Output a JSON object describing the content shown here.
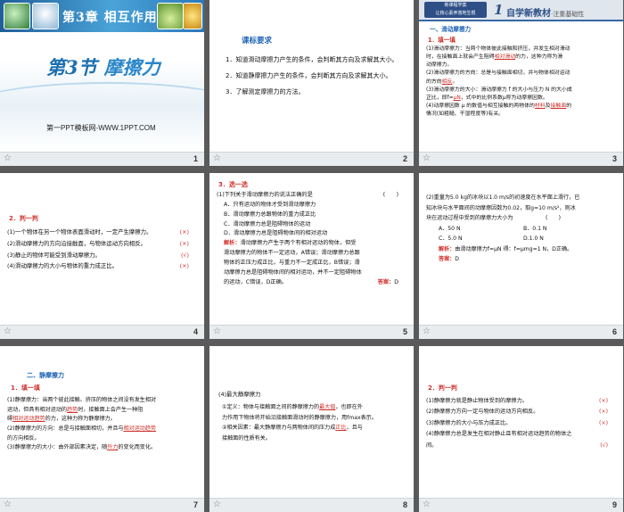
{
  "slides": [
    {
      "number": "1",
      "chapter": "第3章  相互作用",
      "section": "第3节",
      "section_name": "摩擦力",
      "footer": "第一PPT模板网-WWW.1PPT.COM"
    },
    {
      "number": "2",
      "title": "课标要求",
      "items": [
        "1．知道滑动摩擦力产生的条件，会判断其方向及求解其大小。",
        "2．知道静摩擦力产生的条件，会判断其方向及求解其大小。",
        "3．了解测定摩擦力的方法。"
      ]
    },
    {
      "number": "3",
      "badge_line1": "新课程学案",
      "badge_line2": "让核心素养落地生根",
      "header_num": "1",
      "header_title": "自学新教材",
      "header_sub": "·注重基础性",
      "section": "一、滑动摩擦力",
      "sub": "1．填一填",
      "lines": [
        "(1)滑动摩擦力：当两个物体彼此接触和挤压，并发生相对滑动",
        "时，在接触面上就会产生阻碍",
        "的力，这种力称为滑",
        "动摩擦力。",
        "(2)滑动摩擦力的方向：总是与接触面相切，并与物体相对运动",
        "的方向",
        "。",
        "(3)滑动摩擦力的大小：滑动摩擦力 f 的大小与压力 N 的大小成",
        "正比，即f=",
        "，式中的比例系数μ称为动摩擦因数。",
        "(4)动摩擦因数 μ 的数值与相互接触的两物体的",
        "及",
        "的",
        "情况(如粗糙、干湿程度等)有关。"
      ],
      "fill_relative_slide": "相对滑动",
      "fill_opposite": "相反",
      "fill_formula": "μN",
      "fill_material": "材料",
      "fill_surface": "接触面"
    },
    {
      "number": "4",
      "title": "2．判一判",
      "items": [
        {
          "text": "(1)一个物体在另一个物体表面滑动时，一定产生摩擦力。",
          "mark": "(×)"
        },
        {
          "text": "(2)滑动摩擦力的方向沿接触面，与物体运动方向相反。",
          "mark": "(×)"
        },
        {
          "text": "(3)静止的物体可能受到滑动摩擦力。",
          "mark": "(√)"
        },
        {
          "text": "(4)滑动摩擦力的大小与物体的重力成正比。",
          "mark": "(×)"
        }
      ]
    },
    {
      "number": "5",
      "title": "3．选一选",
      "question": "(1)下列关于滑动摩擦力的说法正确的是",
      "paren": "(　　)",
      "options": [
        "A．只有运动的物体才受到滑动摩擦力",
        "B．滑动摩擦力总跟物体的重力成正比",
        "C．滑动摩擦力总是阻碍物体的运动",
        "D．滑动摩擦力总是阻碍物体间的相对运动"
      ],
      "analysis_label": "解析：",
      "analysis": [
        "滑动摩擦力产生于两个有相对运动的物体，但受",
        "滑动摩擦力的物体不一定运动，A错误；滑动摩擦力总跟",
        "物体的正压力成正比，与重力不一定成正比，B错误；滑",
        "动摩擦力总是阻碍物体间的相对运动，并不一定阻碍物体",
        "的运动，C错误，D正确。"
      ],
      "answer_label": "答案：",
      "answer": "D"
    },
    {
      "number": "6",
      "lines": [
        "(2)重量为5.0 kg的冰块以1.0 m/s的初速度在水平面上滑行，已",
        "知冰块与水平面间的动摩擦因数为0.02，取g=10 m/s²，则冰",
        "块在运动过程中受到的摩擦力大小为　　　　　　(　　)"
      ],
      "options": [
        {
          "a": "A．50 N",
          "b": "B．0.1 N"
        },
        {
          "a": "C．5.0 N",
          "b": "D.1.0 N"
        }
      ],
      "analysis_label": "解析：",
      "analysis": "由滑动摩擦力f=μN 得：f=μmg=1 N，D正确。",
      "answer_label": "答案：",
      "answer": "D"
    },
    {
      "number": "7",
      "section": "二、静摩擦力",
      "sub": "1．填一填",
      "lines": [
        "(1)静摩擦力：当两个彼此接触、挤压的物体之间没有发生相对",
        "运动，但具有相对运动的",
        "时，接触面上会产生一种阻",
        "碍",
        "的力，这种力称为静摩擦力。",
        "(2)静摩擦力的方向：总是与接触面相切，并且与",
        "的方向相反。",
        "(3)静摩擦力的大小：由外部因素决定，随",
        "的变化而变化。"
      ],
      "fill_trend": "趋势",
      "fill_relative_trend": "相对运动趋势",
      "fill_relative_trend2": "相对运动趋势",
      "fill_external": "外力"
    },
    {
      "number": "8",
      "title": "(4)最大静摩擦力",
      "lines": [
        "①定义：物体与接触面之间的静摩擦力的",
        "，也即在外",
        "力作用下物体将开始沿接触面滑动时的静摩擦力，用fmax表示。",
        "②相关因素：最大静摩擦力与两物体间的压力成",
        "，且与",
        "接触面的性质有关。"
      ],
      "fill_max": "最大值",
      "fill_proportional": "正比"
    },
    {
      "number": "9",
      "title": "2．判一判",
      "items": [
        {
          "text": "(1)静摩擦力就是静止物体受到的摩擦力。",
          "mark": "(×)"
        },
        {
          "text": "(2)静摩擦力方向一定与物体的运动方向相反。",
          "mark": "(×)"
        },
        {
          "text": "(3)静摩擦力的大小与压力成正比。",
          "mark": "(×)"
        },
        {
          "text": "(4)静摩擦力总是发生在相对静止且有相对运动趋势的物体之",
          "mark": ""
        },
        {
          "text": "间。",
          "mark": "(√)"
        }
      ]
    }
  ],
  "footer_icon": "star-icon"
}
